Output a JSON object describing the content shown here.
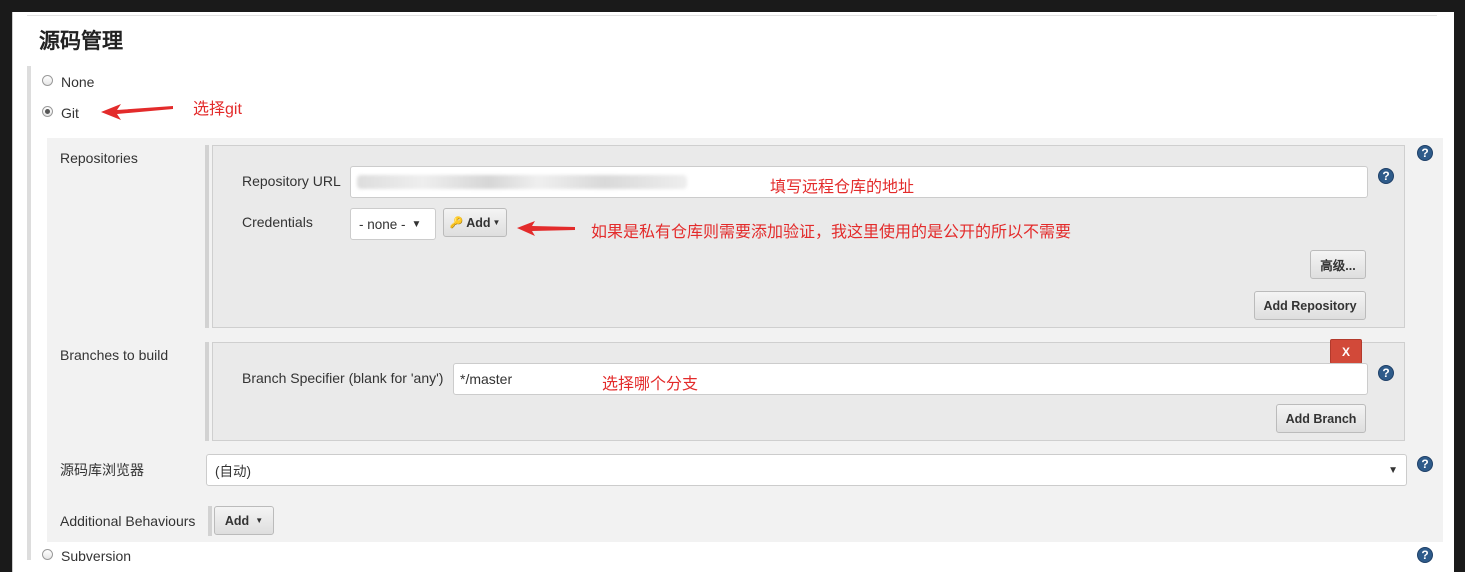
{
  "section": {
    "title": "源码管理"
  },
  "scm_options": {
    "none": "None",
    "git": "Git",
    "subversion": "Subversion"
  },
  "git": {
    "repositories_label": "Repositories",
    "repository_url_label": "Repository URL",
    "credentials_label": "Credentials",
    "credentials_selected": "- none -",
    "credentials_add": "Add",
    "advanced_button": "高级...",
    "add_repository_button": "Add Repository",
    "branches_label": "Branches to build",
    "delete_branch_button": "X",
    "branch_specifier_label": "Branch Specifier (blank for 'any')",
    "branch_specifier_value": "*/master",
    "add_branch_button": "Add Branch",
    "repo_browser_label": "源码库浏览器",
    "repo_browser_value": "(自动)",
    "additional_behaviours_label": "Additional Behaviours",
    "additional_behaviours_add": "Add"
  },
  "annotations": {
    "select_git": "选择git",
    "repo_url_hint": "填写远程仓库的地址",
    "credentials_hint": "如果是私有仓库则需要添加验证，我这里使用的是公开的所以不需要",
    "branch_hint": "选择哪个分支"
  },
  "colors": {
    "annotation_red": "#e32b2b",
    "help_blue": "#2e5b8a",
    "delete_red": "#d24939"
  },
  "icons": {
    "help": "question-circle-icon",
    "key": "key-icon",
    "arrow": "red-arrow-icon"
  }
}
